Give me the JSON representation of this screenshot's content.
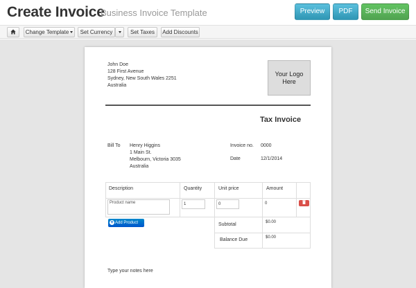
{
  "header": {
    "title": "Create Invoice",
    "subtitle": "Business Invoice Template",
    "preview_label": "Preview",
    "pdf_label": "PDF",
    "send_label": "Send Invoice"
  },
  "toolbar": {
    "home_icon": "home-icon",
    "change_template_label": "Change Template",
    "set_currency_label": "Set Currency",
    "set_taxes_label": "Set Taxes",
    "add_discounts_label": "Add Discounts"
  },
  "sender": {
    "name": "John Doe",
    "address1": "128 First Avenue",
    "address2": "Sydney, New South Wales 2251",
    "country": "Australia"
  },
  "logo": {
    "text": "Your Logo Here"
  },
  "invoice": {
    "title": "Tax Invoice",
    "bill_to_label": "Bill To",
    "number_label": "Invoice no.",
    "number": "0000",
    "date_label": "Date",
    "date": "12/1/2014"
  },
  "recipient": {
    "name": "Henry Higgins",
    "address1": "1 Main St.",
    "address2": "Melbourn, Victoria 3035",
    "country": "Australia"
  },
  "table": {
    "headers": {
      "description": "Description",
      "quantity": "Quantity",
      "unit_price": "Unit price",
      "amount": "Amount"
    },
    "row": {
      "description_placeholder": "Product name",
      "quantity": "1",
      "unit_price": "0",
      "amount": "0"
    },
    "add_product_label": "Add Product",
    "subtotal_label": "Subtotal",
    "subtotal_value": "$0.00",
    "balance_label": "Balance Due",
    "balance_value": "$0.00"
  },
  "notes": {
    "placeholder": "Type your notes here"
  },
  "colors": {
    "info_button": "#49afcd",
    "success_button": "#5bb75b",
    "danger_button": "#da4f49",
    "primary_button": "#006dcc"
  }
}
